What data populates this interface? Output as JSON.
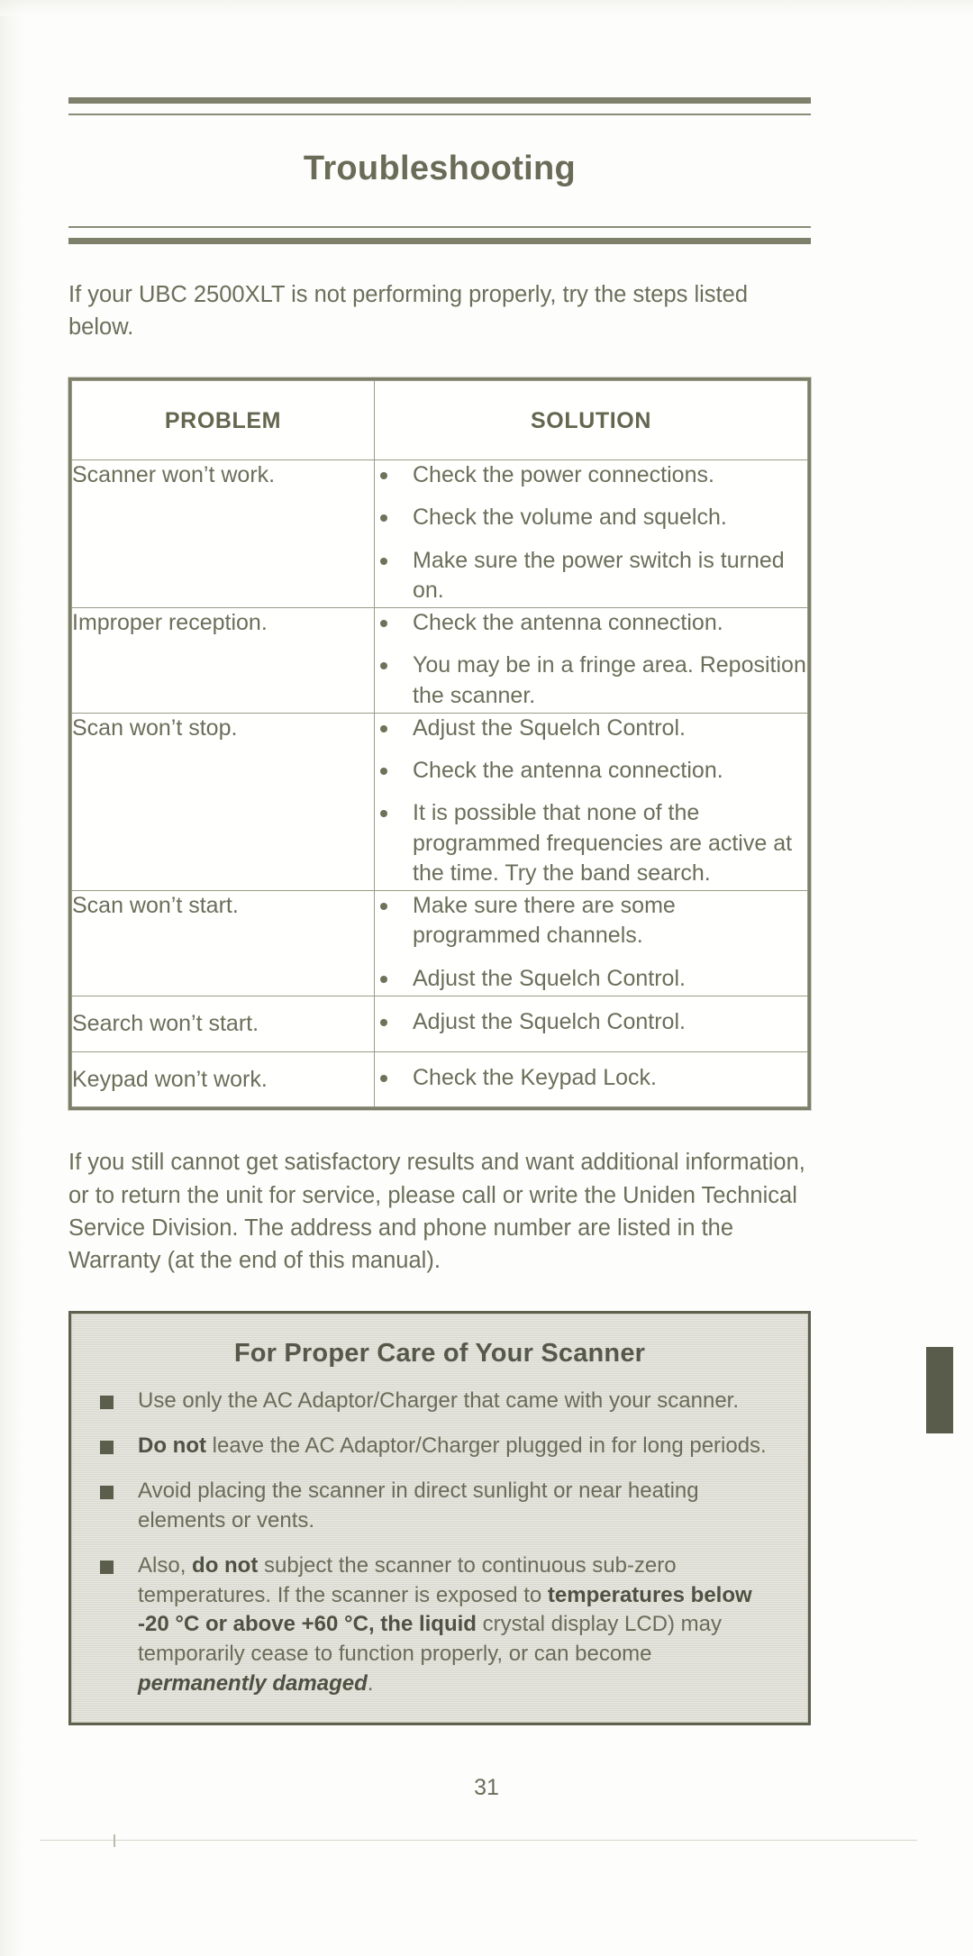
{
  "document": {
    "chapter_title": "Troubleshooting",
    "page_number": "31"
  },
  "intro_paragraph": "If your UBC 2500XLT is not performing properly, try the steps listed below.",
  "table": {
    "headers": {
      "problem": "PROBLEM",
      "solution": "SOLUTION"
    },
    "rows": [
      {
        "problem": "Scanner won’t work.",
        "solutions": [
          "Check the power connections.",
          "Check the volume and squelch.",
          "Make sure the power switch is turned on."
        ]
      },
      {
        "problem": "Improper reception.",
        "solutions": [
          "Check the antenna connection.",
          "You may be in a fringe area. Reposition the scanner."
        ]
      },
      {
        "problem": "Scan won’t stop.",
        "solutions": [
          "Adjust the Squelch Control.",
          "Check the antenna connection.",
          "It is possible that none of the programmed frequencies are active at the time.  Try the band search."
        ]
      },
      {
        "problem": "Scan won’t start.",
        "solutions": [
          "Make sure there are some programmed channels.",
          "Adjust the Squelch Control."
        ]
      },
      {
        "problem": "Search won’t start.",
        "solutions": [
          "Adjust the Squelch Control."
        ]
      },
      {
        "problem": "Keypad won’t work.",
        "solutions": [
          "Check the Keypad Lock."
        ]
      }
    ]
  },
  "closing_paragraph": "If you still cannot get satisfactory results and want additional information, or to return the unit for service, please call or write the Uniden Technical Service Division. The address and phone number are listed in the Warranty (at the end of this manual).",
  "care_box": {
    "title": "For Proper Care of Your Scanner",
    "items": [
      {
        "segments": [
          {
            "text": "Use only the AC Adaptor/Charger that came with your scanner.",
            "style": "normal"
          }
        ]
      },
      {
        "segments": [
          {
            "text": "Do not",
            "style": "bold"
          },
          {
            "text": " leave the AC Adaptor/Charger plugged in for long periods.",
            "style": "normal"
          }
        ]
      },
      {
        "segments": [
          {
            "text": "Avoid placing the scanner in direct sunlight or near heating elements or vents.",
            "style": "normal"
          }
        ]
      },
      {
        "segments": [
          {
            "text": "Also, ",
            "style": "normal"
          },
          {
            "text": "do not",
            "style": "bold"
          },
          {
            "text": " subject the scanner to continuous sub-zero temperatures.  If the scanner is exposed to ",
            "style": "normal"
          },
          {
            "text": "temperatures below -20 °C or above +60 °C, the liquid",
            "style": "bold"
          },
          {
            "text": " crystal display LCD) may temporarily cease to function properly, or can become ",
            "style": "normal"
          },
          {
            "text": "permanently damaged",
            "style": "bold-italic"
          },
          {
            "text": ".",
            "style": "normal"
          }
        ]
      }
    ]
  },
  "colors": {
    "ink": "#6c6e5a",
    "rule": "#7e806c",
    "box_fill": "#dcdcd2",
    "tab": "#5a5c4b"
  }
}
